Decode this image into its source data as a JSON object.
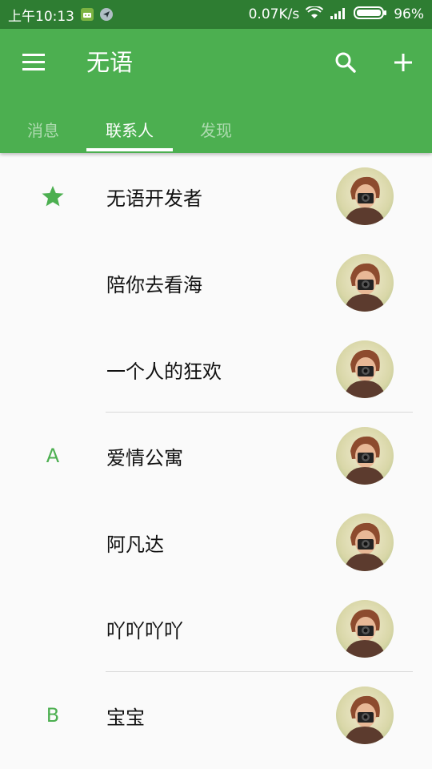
{
  "status_bar": {
    "time": "上午10:13",
    "net_speed": "0.07K/s",
    "battery": "96%"
  },
  "app_bar": {
    "title": "无语",
    "icons": [
      "menu-icon",
      "search-icon",
      "add-icon"
    ]
  },
  "tabs": [
    {
      "label": "消息",
      "active": false
    },
    {
      "label": "联系人",
      "active": true
    },
    {
      "label": "发现",
      "active": false
    }
  ],
  "contacts": [
    {
      "index": "",
      "index_icon": "star-icon",
      "name": "无语开发者"
    },
    {
      "index": "",
      "name": "陪你去看海"
    },
    {
      "index": "",
      "name": "一个人的狂欢"
    },
    {
      "index": "A",
      "name": "爱情公寓"
    },
    {
      "index": "",
      "name": "阿凡达"
    },
    {
      "index": "",
      "name": "吖吖吖吖"
    },
    {
      "index": "B",
      "name": "宝宝"
    }
  ],
  "colors": {
    "primary": "#4caf50",
    "primary_dark": "#2e7d32",
    "background": "#fafafa"
  }
}
